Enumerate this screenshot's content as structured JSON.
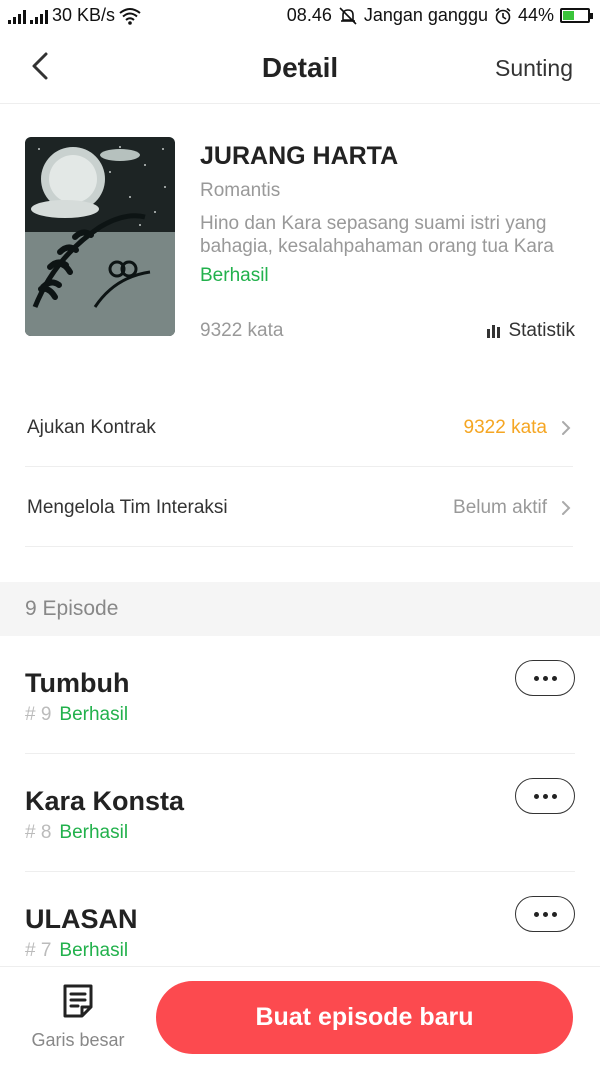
{
  "status_bar": {
    "network_speed": "30 KB/s",
    "time": "08.46",
    "dnd_text": "Jangan ganggu",
    "battery": "44%",
    "battery_level": 0.44
  },
  "header": {
    "title": "Detail",
    "edit_label": "Sunting"
  },
  "book": {
    "title": "JURANG HARTA",
    "genre": "Romantis",
    "synopsis": "Hino dan Kara sepasang suami istri yang bahagia, kesalahpahaman orang tua Kara",
    "status": "Berhasil",
    "word_count": "9322 kata",
    "stats_label": "Statistik"
  },
  "rows": [
    {
      "label": "Ajukan Kontrak",
      "value": "9322 kata"
    },
    {
      "label": "Mengelola Tim Interaksi",
      "value": "Belum aktif"
    }
  ],
  "episodes_header": "9 Episode",
  "episodes": [
    {
      "title": "Tumbuh",
      "number": "# 9",
      "status": "Berhasil"
    },
    {
      "title": "Kara Konsta",
      "number": "# 8",
      "status": "Berhasil"
    },
    {
      "title": "ULASAN",
      "number": "# 7",
      "status": "Berhasil"
    }
  ],
  "bottom": {
    "outline_label": "Garis besar",
    "new_episode_label": "Buat episode baru"
  },
  "colors": {
    "accent_red": "#fc4a4f",
    "success_green": "#22b14c",
    "highlight_orange": "#f5a623"
  }
}
